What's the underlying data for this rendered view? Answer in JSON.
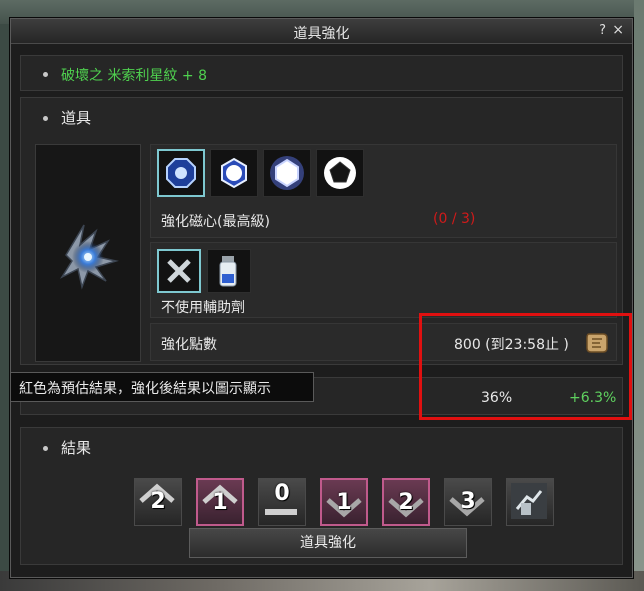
{
  "window": {
    "title": "道具強化",
    "help": "?",
    "close": "×"
  },
  "item": {
    "name": "破壞之 米索利星紋 + 8"
  },
  "section_item": {
    "label": "道具"
  },
  "magnetic_core": {
    "label": "強化磁心(最高級)",
    "count": "(0 / 3)",
    "slots": [
      "core-blue-octagon",
      "core-blue-gem",
      "core-white-glow",
      "core-pentagon"
    ]
  },
  "assist": {
    "label": "不使用輔助劑",
    "slots": [
      "no-assist-x",
      "assist-potion"
    ]
  },
  "points": {
    "label": "強化點數",
    "value": "800 (到23:58止 )"
  },
  "rates": {
    "base": "36%",
    "bonus": "+6.3%"
  },
  "tooltip": {
    "text": "紅色為預估結果，強化後結果以圖示顯示"
  },
  "result": {
    "label": "結果",
    "icons": [
      {
        "name": "result-up-2",
        "num": "2",
        "style": "up"
      },
      {
        "name": "result-up-1",
        "num": "1",
        "style": "up-pink"
      },
      {
        "name": "result-0",
        "num": "0",
        "style": "flat"
      },
      {
        "name": "result-down-1",
        "num": "1",
        "style": "down-pink"
      },
      {
        "name": "result-down-2",
        "num": "2",
        "style": "down-pink"
      },
      {
        "name": "result-down-3",
        "num": "3",
        "style": "down"
      },
      {
        "name": "result-broken",
        "num": "",
        "style": "broken"
      }
    ]
  },
  "button": {
    "label": "道具強化"
  },
  "colors": {
    "item_name": "#4fd14f",
    "count_red": "#d01a1a",
    "bonus_green": "#5fd15f",
    "highlight": "#e01010"
  }
}
